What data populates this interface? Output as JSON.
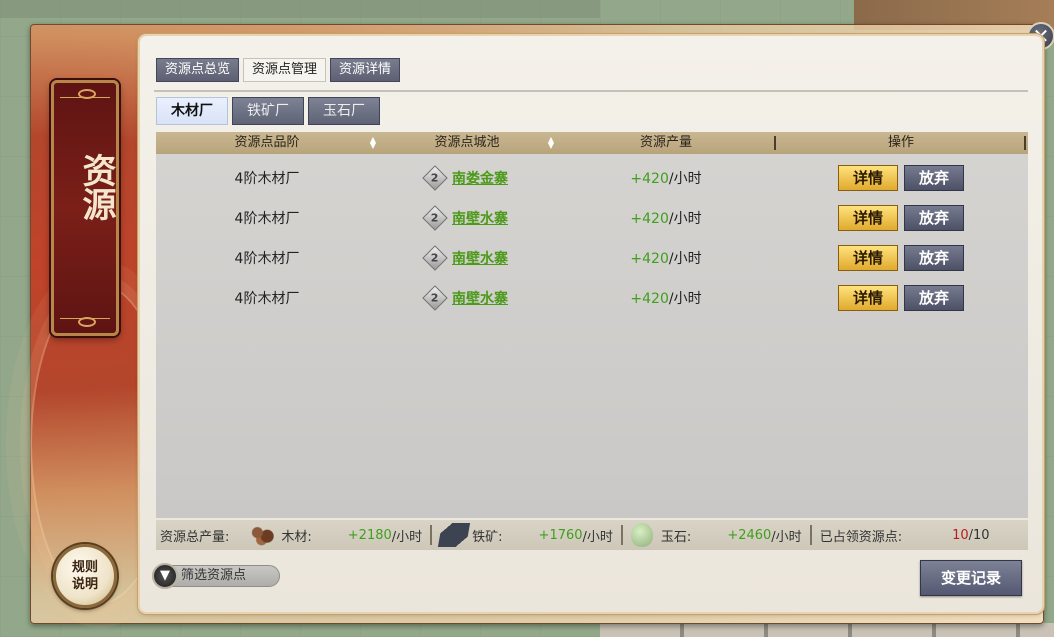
{
  "banner": {
    "title": "资源"
  },
  "rules_button": {
    "label": "规则说明"
  },
  "close_button": {
    "label": "✕"
  },
  "tabs_top": [
    {
      "label": "资源点总览",
      "active": false
    },
    {
      "label": "资源点管理",
      "active": true
    },
    {
      "label": "资源详情",
      "active": false
    }
  ],
  "tabs_sub": [
    {
      "label": "木材厂",
      "active": true
    },
    {
      "label": "铁矿厂",
      "active": false
    },
    {
      "label": "玉石厂",
      "active": false
    }
  ],
  "table": {
    "headers": [
      "资源点品阶",
      "资源点城池",
      "资源产量",
      "操作"
    ],
    "rows": [
      {
        "grade": "4阶木材厂",
        "city_level": "2",
        "city": "南娄金寨",
        "rate": "+420",
        "unit": "/小时"
      },
      {
        "grade": "4阶木材厂",
        "city_level": "2",
        "city": "南壁水寨",
        "rate": "+420",
        "unit": "/小时"
      },
      {
        "grade": "4阶木材厂",
        "city_level": "2",
        "city": "南壁水寨",
        "rate": "+420",
        "unit": "/小时"
      },
      {
        "grade": "4阶木材厂",
        "city_level": "2",
        "city": "南壁水寨",
        "rate": "+420",
        "unit": "/小时"
      }
    ],
    "detail_label": "详情",
    "abandon_label": "放弃"
  },
  "summary": {
    "label": "资源总产量:",
    "wood": {
      "label": "木材:",
      "value": "+2180",
      "unit": "/小时"
    },
    "iron": {
      "label": "铁矿:",
      "value": "+1760",
      "unit": "/小时"
    },
    "jade": {
      "label": "玉石:",
      "value": "+2460",
      "unit": "/小时"
    },
    "occupied": {
      "label": "已占领资源点:",
      "current": "10",
      "max": "/10"
    }
  },
  "filter": {
    "label": "筛选资源点"
  },
  "change_log": {
    "label": "变更记录"
  },
  "colors": {
    "accent_green": "#3f9f1d",
    "accent_red": "#b81c1c",
    "button_gold": "#e0aa2e",
    "button_slate": "#545872"
  }
}
